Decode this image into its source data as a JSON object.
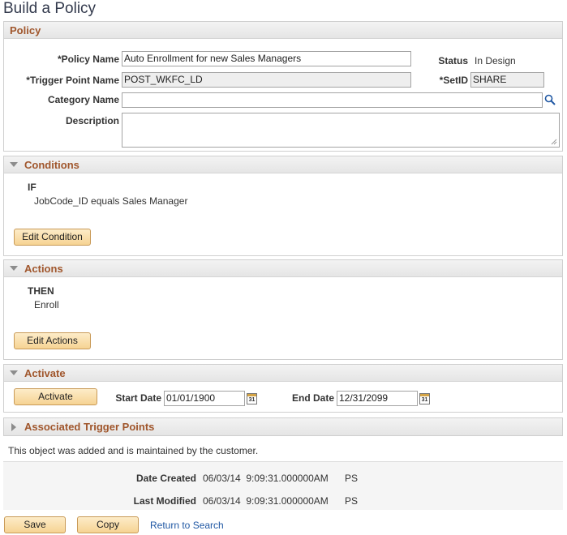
{
  "page": {
    "title": "Build a Policy"
  },
  "policy": {
    "header": "Policy",
    "policy_name_label": "*Policy Name",
    "policy_name_value": "Auto Enrollment for new Sales Managers",
    "status_label": "Status",
    "status_value": "In Design",
    "trigger_label": "*Trigger Point Name",
    "trigger_value": "POST_WKFC_LD",
    "setid_label": "*SetID",
    "setid_value": "SHARE",
    "category_label": "Category Name",
    "category_value": "",
    "description_label": "Description",
    "description_value": ""
  },
  "conditions": {
    "header": "Conditions",
    "keyword": "IF",
    "text": "JobCode_ID equals Sales Manager",
    "button": "Edit Condition"
  },
  "actions": {
    "header": "Actions",
    "keyword": "THEN",
    "text": "Enroll",
    "button": "Edit Actions"
  },
  "activate": {
    "header": "Activate",
    "button": "Activate",
    "start_label": "Start Date",
    "start_value": "01/01/1900",
    "end_label": "End Date",
    "end_value": "12/31/2099",
    "calendar_glyph": "31"
  },
  "trigger_points": {
    "header": "Associated Trigger Points"
  },
  "note": "This object was added and is maintained by the customer.",
  "audit": {
    "created_label": "Date Created",
    "created_value": "06/03/14  9:09:31.000000AM",
    "created_by": "PS",
    "modified_label": "Last Modified",
    "modified_value": "06/03/14  9:09:31.000000AM",
    "modified_by": "PS"
  },
  "footer": {
    "save": "Save",
    "copy": "Copy",
    "return": "Return to Search"
  },
  "colors": {
    "section_header_text": "#a0562c",
    "button_fill": "#f6d393",
    "link": "#1f57a3"
  },
  "icons": {
    "search": "magnifier-icon",
    "calendar": "calendar-icon",
    "collapse": "triangle-down-icon",
    "expand": "triangle-right-icon",
    "resize": "resize-grip-icon"
  }
}
